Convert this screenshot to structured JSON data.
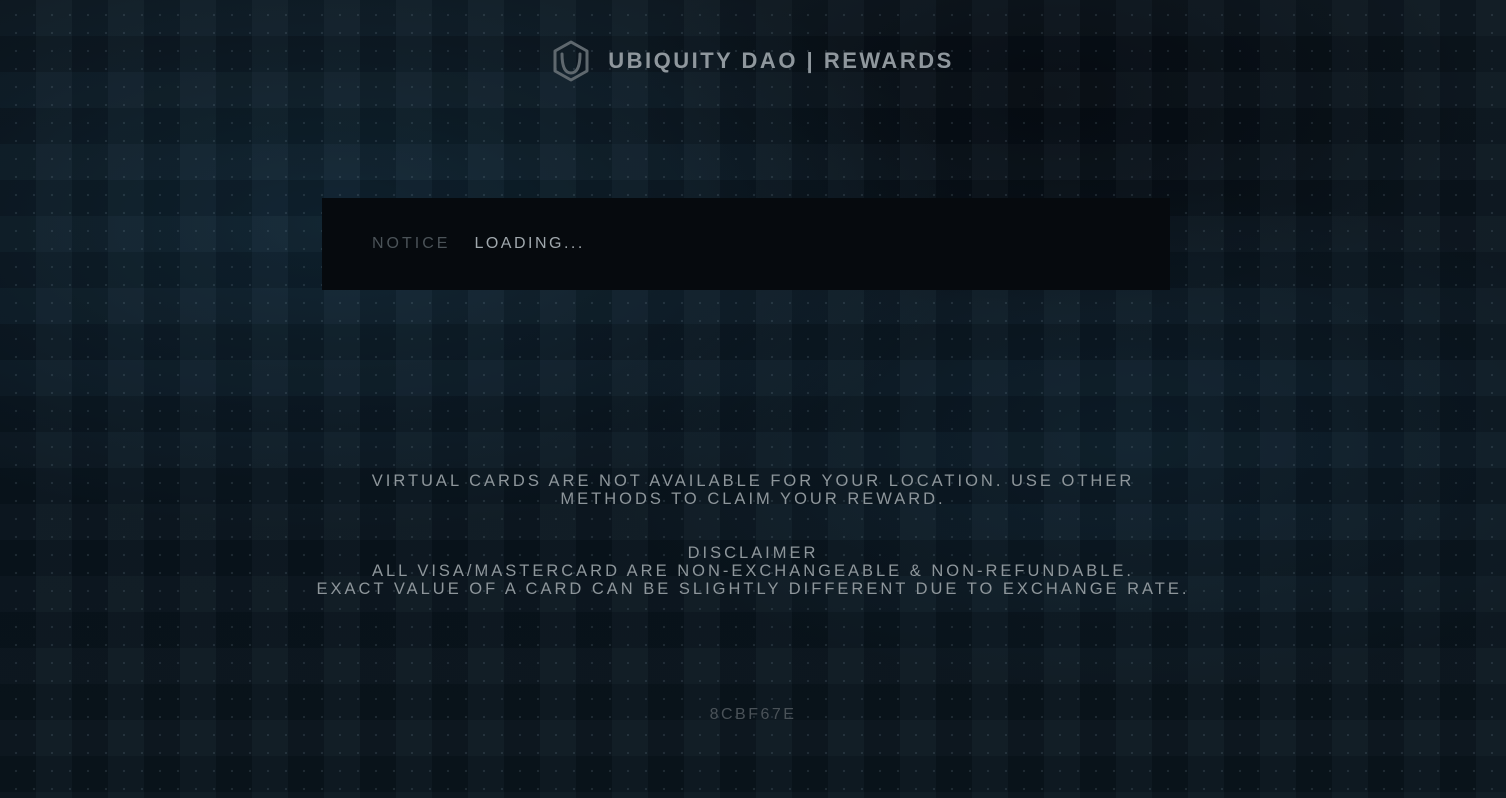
{
  "header": {
    "logo_icon": "ubiquity-hexagon-logo-icon",
    "title": "UBIQUITY DAO | REWARDS"
  },
  "notice": {
    "label": "NOTICE",
    "value": "LOADING..."
  },
  "messages": {
    "location_line1": "VIRTUAL CARDS ARE NOT AVAILABLE FOR YOUR LOCATION. USE OTHER",
    "location_line2": "METHODS TO CLAIM YOUR REWARD.",
    "disclaimer_title": "DISCLAIMER",
    "disclaimer_line1": "ALL VISA/MASTERCARD ARE NON-EXCHANGEABLE & NON-REFUNDABLE.",
    "disclaimer_line2": "EXACT VALUE OF A CARD CAN BE SLIGHTLY DIFFERENT DUE TO EXCHANGE RATE."
  },
  "footer": {
    "commit_hash": "8CBF67E"
  },
  "colors": {
    "background": "#0b141c",
    "notice_background": "#060a0e",
    "text": "#8e969b",
    "muted_text": "#4b5358"
  }
}
